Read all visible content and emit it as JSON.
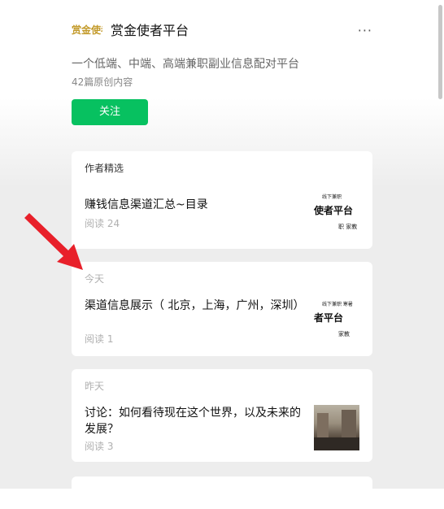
{
  "account": {
    "name": "赏金使者平台",
    "logo_text": "赏金使者",
    "description": "一个低端、中端、高端兼职副业信息配对平台",
    "article_count": "42篇原创内容",
    "follow_label": "关注",
    "more_icon": "···"
  },
  "sections": [
    {
      "label": "作者精选",
      "articles": [
        {
          "title": "赚钱信息渠道汇总~目录",
          "reads": "阅读 24",
          "thumb": "poster"
        }
      ]
    },
    {
      "label": "今天",
      "articles": [
        {
          "title": "渠道信息展示（ 北京，上海，广州，深圳）",
          "reads": "阅读 1",
          "thumb": "poster"
        }
      ]
    },
    {
      "label": "昨天",
      "articles": [
        {
          "title": "讨论：如何看待现在这个世界，以及未来的发展？",
          "reads": "阅读 3",
          "thumb": "photo"
        }
      ]
    },
    {
      "label": "",
      "articles": []
    }
  ],
  "poster_thumb_1": {
    "line1": "线下兼职",
    "line2": "使者平台",
    "line3": "职  家教"
  },
  "poster_thumb_2": {
    "line1": "线下兼职   寒暑",
    "line2": "者平台",
    "line3": "家教"
  },
  "colors": {
    "accent": "#07c160",
    "arrow": "#e8202a"
  }
}
